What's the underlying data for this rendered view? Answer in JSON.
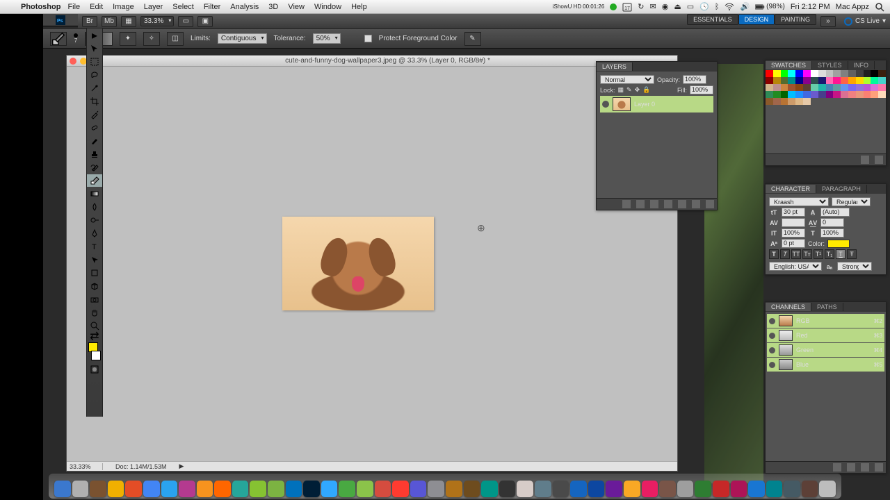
{
  "menubar": {
    "app": "Photoshop",
    "menus": [
      "File",
      "Edit",
      "Image",
      "Layer",
      "Select",
      "Filter",
      "Analysis",
      "3D",
      "View",
      "Window",
      "Help"
    ],
    "status": {
      "cal": "17",
      "battery": "(98%)",
      "clock": "Fri 2:12 PM",
      "user": "Mac Appz",
      "showu_timer": "00:01:26",
      "showu_label": "iShowU HD"
    }
  },
  "optbar1": {
    "zoom": "33.3%",
    "workspaces": [
      "ESSENTIALS",
      "DESIGN",
      "PAINTING"
    ],
    "activeWorkspace": 1,
    "cslive": "CS Live"
  },
  "optbar2": {
    "brushSize": "7",
    "limitsLabel": "Limits:",
    "limitsValue": "Contiguous",
    "toleranceLabel": "Tolerance:",
    "toleranceValue": "50%",
    "protectLabel": "Protect Foreground Color"
  },
  "document": {
    "title": "cute-and-funny-dog-wallpaper3.jpeg @ 33.3% (Layer 0, RGB/8#) *",
    "statusZoom": "33.33%",
    "statusDoc": "Doc: 1.14M/1.53M"
  },
  "layers": {
    "tab": "LAYERS",
    "blend": "Normal",
    "opacityLabel": "Opacity:",
    "opacityValue": "100%",
    "lockLabel": "Lock:",
    "fillLabel": "Fill:",
    "fillValue": "100%",
    "layerName": "Layer 0"
  },
  "swatches": {
    "tabA": "SWATCHES",
    "tabB": "STYLES",
    "tabC": "INFO",
    "colors": [
      "#ff0000",
      "#ffff00",
      "#00ff00",
      "#00ffff",
      "#0000ff",
      "#ff00ff",
      "#ffffff",
      "#dcdcdc",
      "#c0c0c0",
      "#a0a0a0",
      "#808080",
      "#606060",
      "#404040",
      "#202020",
      "#000000",
      "#3a1f0f",
      "#8b0000",
      "#b8860b",
      "#556b2f",
      "#008b8b",
      "#00008b",
      "#8b008b",
      "#2f4f4f",
      "#191970",
      "#ff69b4",
      "#ff1493",
      "#ff6347",
      "#ffa500",
      "#ffd700",
      "#adff2f",
      "#00fa9a",
      "#48d1cc",
      "#d2b48c",
      "#bc8f8f",
      "#cd853f",
      "#a0522d",
      "#8b4513",
      "#5c4033",
      "#66cdaa",
      "#20b2aa",
      "#4682b4",
      "#5f9ea0",
      "#6495ed",
      "#7b68ee",
      "#9370db",
      "#ba55d3",
      "#da70d6",
      "#ff77aa",
      "#2e8b57",
      "#228b22",
      "#006400",
      "#00bfff",
      "#1e90ff",
      "#4169e1",
      "#6a5acd",
      "#483d8b",
      "#800080",
      "#c71585",
      "#db7093",
      "#f08080",
      "#e9967a",
      "#fa8072",
      "#ffa07a",
      "#ffdab9",
      "#8b5a2b",
      "#a0664b",
      "#b87333",
      "#cd9b6a",
      "#deb887",
      "#e6c9a8"
    ]
  },
  "character": {
    "tabA": "CHARACTER",
    "tabB": "PARAGRAPH",
    "font": "Kraash",
    "weight": "Regular",
    "size": "30 pt",
    "leading": "(Auto)",
    "tracking": "0",
    "kerning": "",
    "vscale": "100%",
    "hscale": "100%",
    "baseline": "0 pt",
    "colorLabel": "Color:",
    "lang": "English: USA",
    "aa": "Strong"
  },
  "channels": {
    "tabA": "CHANNELS",
    "tabB": "PATHS",
    "items": [
      {
        "name": "RGB",
        "sc": "⌘2",
        "bg": "linear-gradient(#f5d7ad,#b97a4a)"
      },
      {
        "name": "Red",
        "sc": "⌘3",
        "bg": "linear-gradient(#eee,#bbb)"
      },
      {
        "name": "Green",
        "sc": "⌘4",
        "bg": "linear-gradient(#ddd,#999)"
      },
      {
        "name": "Blue",
        "sc": "⌘5",
        "bg": "linear-gradient(#ccc,#888)"
      }
    ]
  },
  "dock": {
    "items": [
      "#3b78ce",
      "#b0b0b0",
      "#7a5230",
      "#f0b000",
      "#e44d26",
      "#4285f4",
      "#2aa3ef",
      "#b43a8f",
      "#f7931e",
      "#ff6600",
      "#26a69a",
      "#86c232",
      "#7cb342",
      "#0071bc",
      "#001e36",
      "#31a8ff",
      "#49a942",
      "#8bc34a",
      "#d54c3f",
      "#ff3b30",
      "#5856d6",
      "#8e8e93",
      "#b07219",
      "#6e4c1e",
      "#009688",
      "#333333",
      "#d7ccc8",
      "#607d8b",
      "#4a4a4a",
      "#1565c0",
      "#0d47a1",
      "#6a1b9a",
      "#f9a825",
      "#e91e63",
      "#795548",
      "#9e9e9e",
      "#2e7d32",
      "#c62828",
      "#ad1457",
      "#1976d2",
      "#00838f",
      "#455a64",
      "#5d4037",
      "#bdbdbd"
    ]
  }
}
